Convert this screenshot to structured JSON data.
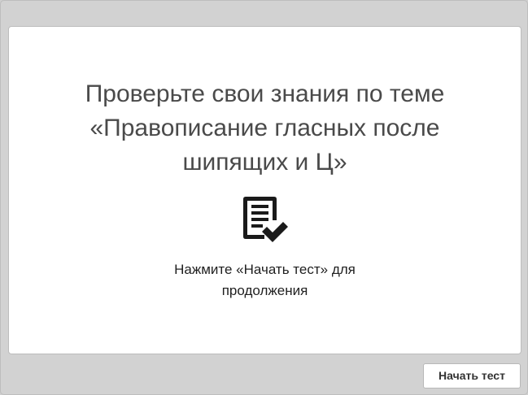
{
  "content": {
    "title_lines": [
      "Проверьте свои знания по теме",
      "«Правописание гласных после",
      "шипящих и Ц»"
    ],
    "icon": "document-checkmark-icon",
    "instruction_lines": [
      "Нажмите «Начать тест» для",
      "продолжения"
    ]
  },
  "footer": {
    "start_button_label": "Начать тест"
  },
  "colors": {
    "background": "#d2d2d2",
    "card": "#ffffff",
    "title_text": "#4a4a4a",
    "icon": "#1a1a1a"
  }
}
